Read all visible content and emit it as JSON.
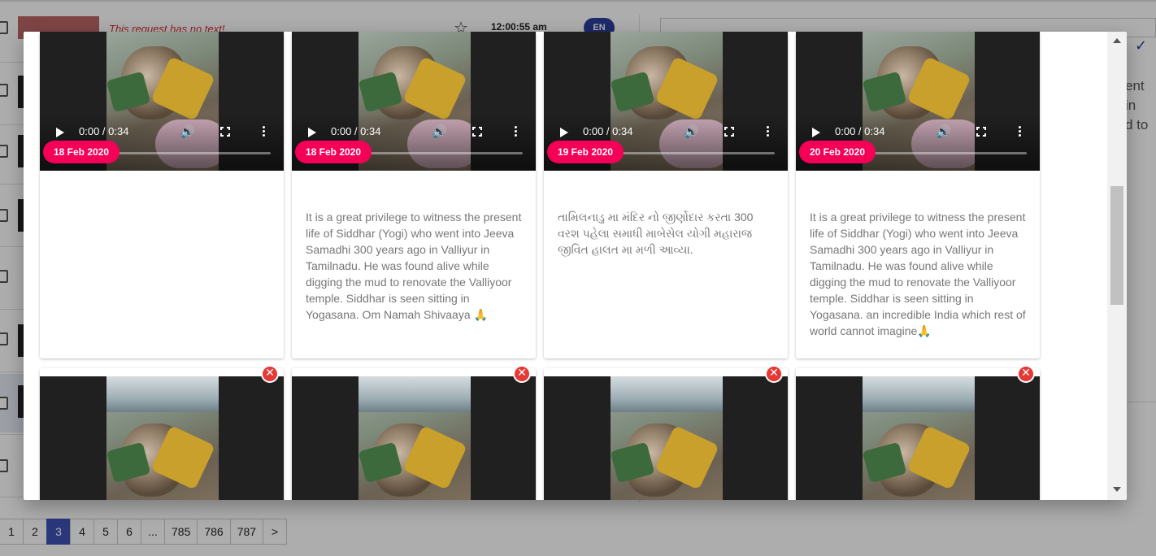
{
  "background": {
    "row_title": "This request has no text!",
    "row_time": "12:00:55 am",
    "row_lang": "EN",
    "right_text_line1": "ent in",
    "right_text_line2": "d to",
    "pagination": [
      "1",
      "2",
      "3",
      "4",
      "5",
      "6",
      "...",
      "785",
      "786",
      "787",
      ">"
    ],
    "active_page": "3"
  },
  "modal": {
    "top_cards": [
      {
        "date": "18 Feb 2020",
        "time": "0:00 / 0:34",
        "progress": 0.22,
        "text": ""
      },
      {
        "date": "18 Feb 2020",
        "time": "0:00 / 0:34",
        "progress": 0.22,
        "text": "It is a great privilege to witness the present life of Siddhar (Yogi) who went into Jeeva Samadhi 300 years ago in Valliyur in Tamilnadu. He was found alive while digging the mud to renovate the Valliyoor temple. Siddhar is seen sitting in Yogasana. Om Namah Shivaaya 🙏"
      },
      {
        "date": "19 Feb 2020",
        "time": "0:00 / 0:34",
        "progress": 0.22,
        "text": "તામિલનાડુ મા મંદિર નો જીર્ણોદાર કરતા 300 વરશ પહેલા સમાધી માબેસેલ યોગી મહારાજ જીવિત હાલત મા મળી આવ્યા."
      },
      {
        "date": "20 Feb 2020",
        "time": "0:00 / 0:34",
        "progress": 0.22,
        "text": "It is a great privilege to witness the present life of Siddhar (Yogi) who went into Jeeva Samadhi 300 years ago in Valliyur in Tamilnadu. He was found alive while digging the mud to renovate the Valliyoor temple. Siddhar is seen sitting in Yogasana. an incredible India which rest of world cannot imagine🙏"
      }
    ],
    "bottom_cards": [
      {
        "close": "✕"
      },
      {
        "close": "✕"
      },
      {
        "close": "✕"
      },
      {
        "close": "✕"
      }
    ]
  },
  "colors": {
    "date_pill": "#f50057",
    "close_button": "#e53935",
    "active_page": "#3f51b5"
  },
  "icons": {
    "star": "star-icon",
    "play": "play-icon",
    "volume": "volume-icon",
    "fullscreen": "fullscreen-icon",
    "more": "more-vert-icon",
    "close": "close-icon"
  }
}
